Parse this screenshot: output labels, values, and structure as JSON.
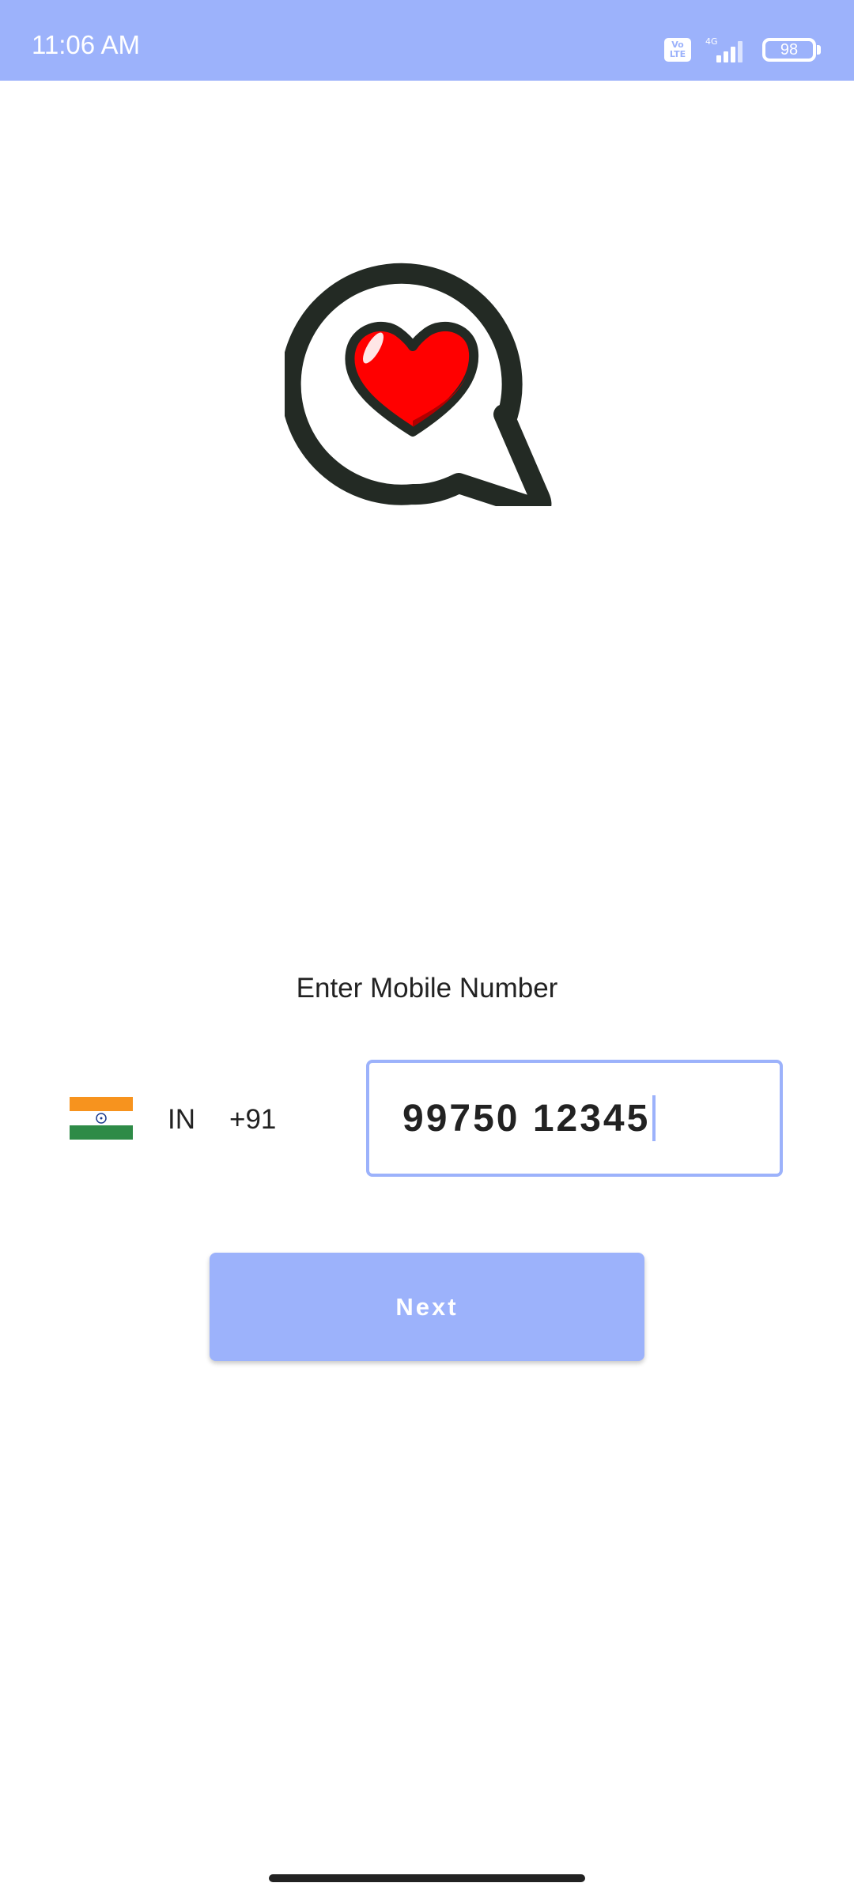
{
  "status_bar": {
    "time": "11:06 AM",
    "volte_label": "Vo LTE",
    "network_label": "4G",
    "battery_level": "98",
    "icons": [
      "volte-icon",
      "signal-icon",
      "battery-icon"
    ]
  },
  "logo": {
    "icon": "chat-heart-logo-icon"
  },
  "login": {
    "prompt": "Enter Mobile Number",
    "country_flag_icon": "india-flag-icon",
    "country_code": "IN",
    "dial_code": "+91",
    "phone_value": "99750 12345",
    "next_label": "Next"
  },
  "colors": {
    "accent": "#9cb2fb",
    "text": "#222222",
    "heart": "#ff0000",
    "logo_outline": "#232a24",
    "flag_saffron": "#f7931e",
    "flag_white": "#ffffff",
    "flag_green": "#2e8b47",
    "flag_chakra": "#1b3a8c"
  }
}
